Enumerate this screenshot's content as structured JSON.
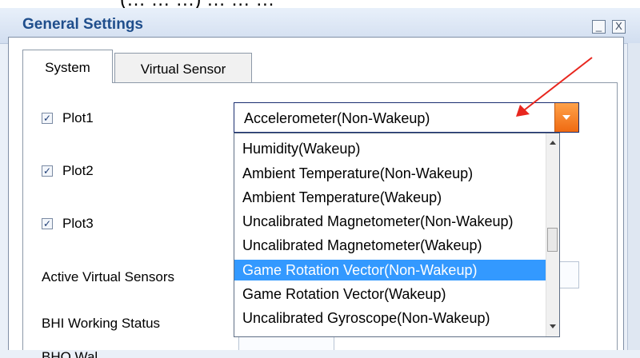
{
  "top_fragment": "(… … …) … … …",
  "window": {
    "title": "General Settings",
    "minimize_glyph": "_",
    "close_glyph": "X"
  },
  "tabs": [
    {
      "label": "System",
      "selected": true
    },
    {
      "label": "Virtual Sensor",
      "selected": false
    }
  ],
  "plots": [
    {
      "label": "Plot1",
      "checked": true
    },
    {
      "label": "Plot2",
      "checked": true
    },
    {
      "label": "Plot3",
      "checked": true
    }
  ],
  "checkbox_glyph": "✓",
  "labels": {
    "active_virtual_sensors": "Active Virtual Sensors",
    "bhi_working_status": "BHI Working Status",
    "partial_bottom": "BHO Wal…"
  },
  "combo": {
    "value": "Accelerometer(Non-Wakeup)",
    "button_color": "#f07a1e"
  },
  "dropdown": {
    "items": [
      "Humidity(Wakeup)",
      "Ambient Temperature(Non-Wakeup)",
      "Ambient Temperature(Wakeup)",
      "Uncalibrated Magnetometer(Non-Wakeup)",
      "Uncalibrated Magnetometer(Wakeup)",
      "Game Rotation Vector(Non-Wakeup)",
      "Game Rotation Vector(Wakeup)",
      "Uncalibrated Gyroscope(Non-Wakeup)"
    ],
    "selected_item": "Game Rotation Vector(Non-Wakeup)",
    "highlight_color": "#3399ff"
  },
  "annotation": {
    "arrow_color": "#e8261e"
  }
}
